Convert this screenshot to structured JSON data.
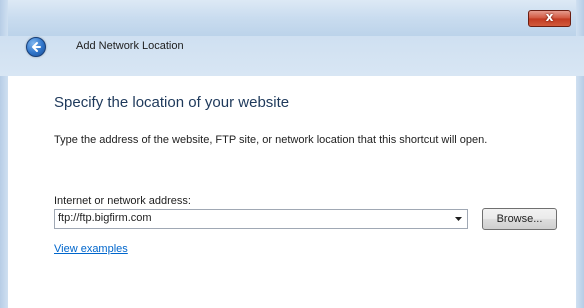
{
  "window": {
    "close_label": "x"
  },
  "header": {
    "title": "Add Network Location"
  },
  "main": {
    "heading": "Specify the location of your website",
    "description": "Type the address of the website, FTP site, or network location that this shortcut will open.",
    "address_label": "Internet or network address:",
    "address_value": "ftp://ftp.bigfirm.com",
    "browse_label": "Browse...",
    "examples_link": "View examples"
  },
  "colors": {
    "heading": "#1e395b",
    "link": "#0066cc",
    "close": "#c23a22",
    "frame": "#c9dcef"
  }
}
